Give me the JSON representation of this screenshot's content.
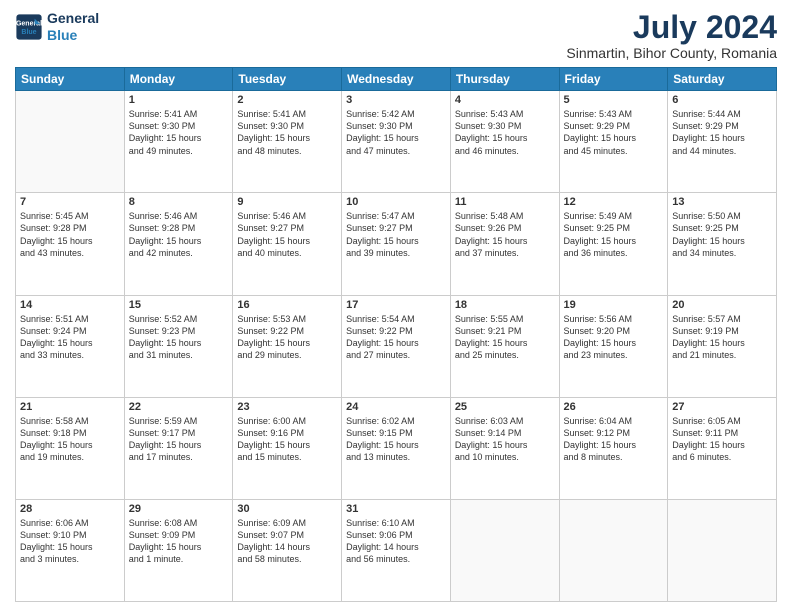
{
  "header": {
    "logo_line1": "General",
    "logo_line2": "Blue",
    "title": "July 2024",
    "subtitle": "Sinmartin, Bihor County, Romania"
  },
  "weekdays": [
    "Sunday",
    "Monday",
    "Tuesday",
    "Wednesday",
    "Thursday",
    "Friday",
    "Saturday"
  ],
  "weeks": [
    [
      {
        "day": "",
        "info": ""
      },
      {
        "day": "1",
        "info": "Sunrise: 5:41 AM\nSunset: 9:30 PM\nDaylight: 15 hours\nand 49 minutes."
      },
      {
        "day": "2",
        "info": "Sunrise: 5:41 AM\nSunset: 9:30 PM\nDaylight: 15 hours\nand 48 minutes."
      },
      {
        "day": "3",
        "info": "Sunrise: 5:42 AM\nSunset: 9:30 PM\nDaylight: 15 hours\nand 47 minutes."
      },
      {
        "day": "4",
        "info": "Sunrise: 5:43 AM\nSunset: 9:30 PM\nDaylight: 15 hours\nand 46 minutes."
      },
      {
        "day": "5",
        "info": "Sunrise: 5:43 AM\nSunset: 9:29 PM\nDaylight: 15 hours\nand 45 minutes."
      },
      {
        "day": "6",
        "info": "Sunrise: 5:44 AM\nSunset: 9:29 PM\nDaylight: 15 hours\nand 44 minutes."
      }
    ],
    [
      {
        "day": "7",
        "info": "Sunrise: 5:45 AM\nSunset: 9:28 PM\nDaylight: 15 hours\nand 43 minutes."
      },
      {
        "day": "8",
        "info": "Sunrise: 5:46 AM\nSunset: 9:28 PM\nDaylight: 15 hours\nand 42 minutes."
      },
      {
        "day": "9",
        "info": "Sunrise: 5:46 AM\nSunset: 9:27 PM\nDaylight: 15 hours\nand 40 minutes."
      },
      {
        "day": "10",
        "info": "Sunrise: 5:47 AM\nSunset: 9:27 PM\nDaylight: 15 hours\nand 39 minutes."
      },
      {
        "day": "11",
        "info": "Sunrise: 5:48 AM\nSunset: 9:26 PM\nDaylight: 15 hours\nand 37 minutes."
      },
      {
        "day": "12",
        "info": "Sunrise: 5:49 AM\nSunset: 9:25 PM\nDaylight: 15 hours\nand 36 minutes."
      },
      {
        "day": "13",
        "info": "Sunrise: 5:50 AM\nSunset: 9:25 PM\nDaylight: 15 hours\nand 34 minutes."
      }
    ],
    [
      {
        "day": "14",
        "info": "Sunrise: 5:51 AM\nSunset: 9:24 PM\nDaylight: 15 hours\nand 33 minutes."
      },
      {
        "day": "15",
        "info": "Sunrise: 5:52 AM\nSunset: 9:23 PM\nDaylight: 15 hours\nand 31 minutes."
      },
      {
        "day": "16",
        "info": "Sunrise: 5:53 AM\nSunset: 9:22 PM\nDaylight: 15 hours\nand 29 minutes."
      },
      {
        "day": "17",
        "info": "Sunrise: 5:54 AM\nSunset: 9:22 PM\nDaylight: 15 hours\nand 27 minutes."
      },
      {
        "day": "18",
        "info": "Sunrise: 5:55 AM\nSunset: 9:21 PM\nDaylight: 15 hours\nand 25 minutes."
      },
      {
        "day": "19",
        "info": "Sunrise: 5:56 AM\nSunset: 9:20 PM\nDaylight: 15 hours\nand 23 minutes."
      },
      {
        "day": "20",
        "info": "Sunrise: 5:57 AM\nSunset: 9:19 PM\nDaylight: 15 hours\nand 21 minutes."
      }
    ],
    [
      {
        "day": "21",
        "info": "Sunrise: 5:58 AM\nSunset: 9:18 PM\nDaylight: 15 hours\nand 19 minutes."
      },
      {
        "day": "22",
        "info": "Sunrise: 5:59 AM\nSunset: 9:17 PM\nDaylight: 15 hours\nand 17 minutes."
      },
      {
        "day": "23",
        "info": "Sunrise: 6:00 AM\nSunset: 9:16 PM\nDaylight: 15 hours\nand 15 minutes."
      },
      {
        "day": "24",
        "info": "Sunrise: 6:02 AM\nSunset: 9:15 PM\nDaylight: 15 hours\nand 13 minutes."
      },
      {
        "day": "25",
        "info": "Sunrise: 6:03 AM\nSunset: 9:14 PM\nDaylight: 15 hours\nand 10 minutes."
      },
      {
        "day": "26",
        "info": "Sunrise: 6:04 AM\nSunset: 9:12 PM\nDaylight: 15 hours\nand 8 minutes."
      },
      {
        "day": "27",
        "info": "Sunrise: 6:05 AM\nSunset: 9:11 PM\nDaylight: 15 hours\nand 6 minutes."
      }
    ],
    [
      {
        "day": "28",
        "info": "Sunrise: 6:06 AM\nSunset: 9:10 PM\nDaylight: 15 hours\nand 3 minutes."
      },
      {
        "day": "29",
        "info": "Sunrise: 6:08 AM\nSunset: 9:09 PM\nDaylight: 15 hours\nand 1 minute."
      },
      {
        "day": "30",
        "info": "Sunrise: 6:09 AM\nSunset: 9:07 PM\nDaylight: 14 hours\nand 58 minutes."
      },
      {
        "day": "31",
        "info": "Sunrise: 6:10 AM\nSunset: 9:06 PM\nDaylight: 14 hours\nand 56 minutes."
      },
      {
        "day": "",
        "info": ""
      },
      {
        "day": "",
        "info": ""
      },
      {
        "day": "",
        "info": ""
      }
    ]
  ]
}
